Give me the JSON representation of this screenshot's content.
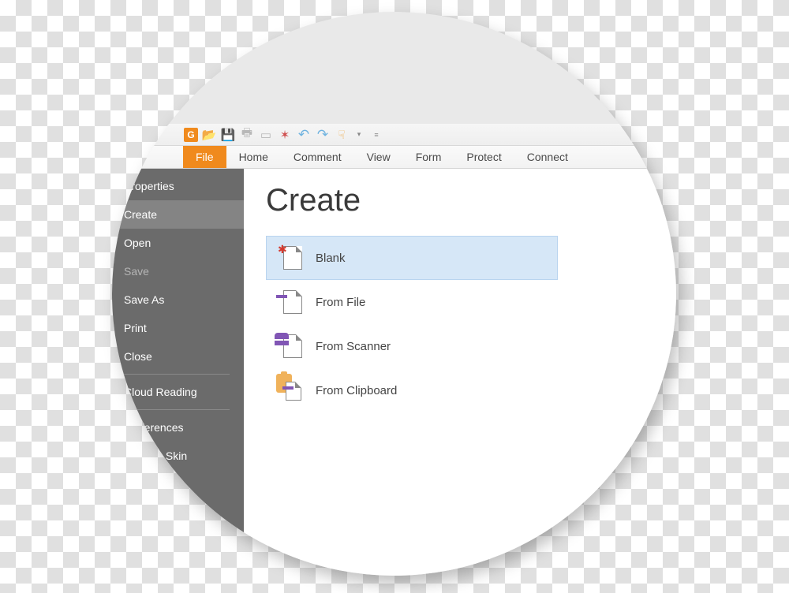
{
  "ribbon": {
    "tabs": [
      "File",
      "Home",
      "Comment",
      "View",
      "Form",
      "Protect",
      "Connect"
    ],
    "active": 0
  },
  "sidebar": {
    "items": [
      {
        "label": "Properties",
        "state": ""
      },
      {
        "label": "Create",
        "state": "selected"
      },
      {
        "label": "Open",
        "state": ""
      },
      {
        "label": "Save",
        "state": "disabled"
      },
      {
        "label": "Save As",
        "state": ""
      },
      {
        "label": "Print",
        "state": ""
      },
      {
        "label": "Close",
        "state": ""
      },
      {
        "sep": true
      },
      {
        "label": "Cloud Reading",
        "state": ""
      },
      {
        "sep": true
      },
      {
        "label": "Preferences",
        "state": ""
      },
      {
        "label": "Change Skin",
        "state": ""
      }
    ]
  },
  "content": {
    "title": "Create",
    "options": [
      {
        "label": "Blank",
        "selected": true,
        "icon": "blank"
      },
      {
        "label": "From File",
        "selected": false,
        "icon": "file"
      },
      {
        "label": "From Scanner",
        "selected": false,
        "icon": "scanner"
      },
      {
        "label": "From Clipboard",
        "selected": false,
        "icon": "clipboard"
      }
    ]
  },
  "colors": {
    "accent": "#f08a1d",
    "sidebar": "#6b6b6b",
    "selection": "#d6e7f7"
  }
}
